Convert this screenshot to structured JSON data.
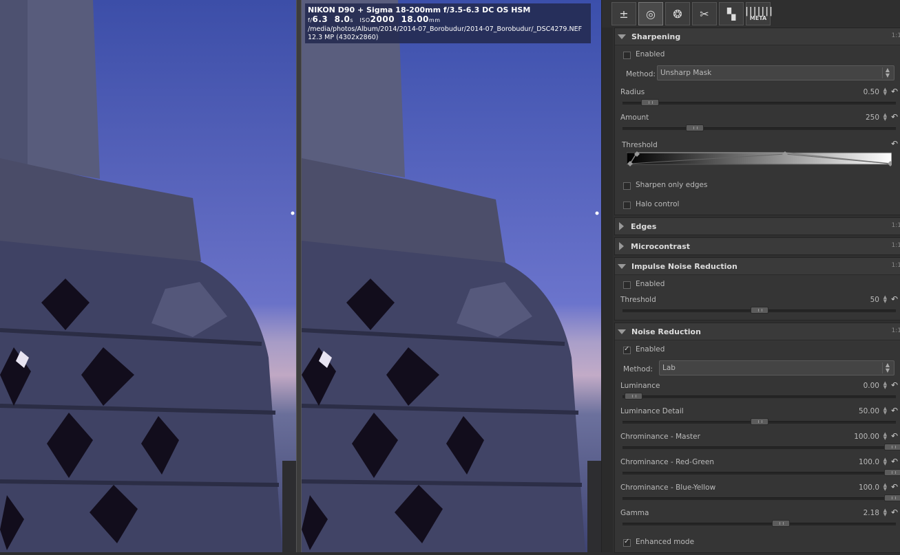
{
  "image_info": {
    "camera_lens": "NIKON D90 + Sigma 18-200mm f/3.5-6.3 DC OS HSM",
    "fnumber_prefix": "f/",
    "fnumber": "6.3",
    "shutter": "8.0",
    "shutter_unit": "s",
    "iso_label": "ISO",
    "iso": "2000",
    "focal": "18.00",
    "focal_unit": "mm",
    "path": "/media/photos/Album/2014/2014-07_Borobudur/2014-07_Borobudur/_DSC4279.NEF",
    "megapixels": "12.3 MP (4302x2860)"
  },
  "tabs": [
    {
      "name": "exposure",
      "icon": "exposure-tab-icon"
    },
    {
      "name": "detail",
      "icon": "detail-tab-icon",
      "active": true
    },
    {
      "name": "color",
      "icon": "color-tab-icon"
    },
    {
      "name": "transform",
      "icon": "transform-tab-icon"
    },
    {
      "name": "raw",
      "icon": "raw-tab-icon"
    },
    {
      "name": "meta",
      "icon": "barcode-icon",
      "label": "META"
    }
  ],
  "sharpening": {
    "title": "Sharpening",
    "ratio": "1:1",
    "enabled_label": "Enabled",
    "enabled": false,
    "method_label": "Method:",
    "method_value": "Unsharp Mask",
    "radius_label": "Radius",
    "radius_value": "0.50",
    "radius_fraction": 0.1,
    "amount_label": "Amount",
    "amount_value": "250",
    "amount_fraction": 0.265,
    "threshold_label": "Threshold",
    "edges_only_label": "Sharpen only edges",
    "halo_label": "Halo control"
  },
  "edges": {
    "title": "Edges",
    "ratio": "1:1"
  },
  "microcontrast": {
    "title": "Microcontrast",
    "ratio": "1:1"
  },
  "impulse": {
    "title": "Impulse Noise Reduction",
    "ratio": "1:1",
    "enabled_label": "Enabled",
    "threshold_label": "Threshold",
    "threshold_value": "50",
    "threshold_fraction": 0.5
  },
  "noise": {
    "title": "Noise Reduction",
    "ratio": "1:1",
    "enabled_label": "Enabled",
    "enabled": true,
    "method_label": "Method:",
    "method_value": "Lab",
    "luminance_label": "Luminance",
    "luminance_value": "0.00",
    "luminance_fraction": 0.04,
    "lum_detail_label": "Luminance Detail",
    "lum_detail_value": "50.00",
    "lum_detail_fraction": 0.5,
    "chroma_master_label": "Chrominance - Master",
    "chroma_master_value": "100.00",
    "chroma_master_fraction": 0.99,
    "chroma_rg_label": "Chrominance - Red-Green",
    "chroma_rg_value": "100.0",
    "chroma_rg_fraction": 0.99,
    "chroma_by_label": "Chrominance - Blue-Yellow",
    "chroma_by_value": "100.0",
    "chroma_by_fraction": 0.99,
    "gamma_label": "Gamma",
    "gamma_value": "2.18",
    "gamma_fraction": 0.58,
    "enhanced_label": "Enhanced mode",
    "enhanced": true
  }
}
